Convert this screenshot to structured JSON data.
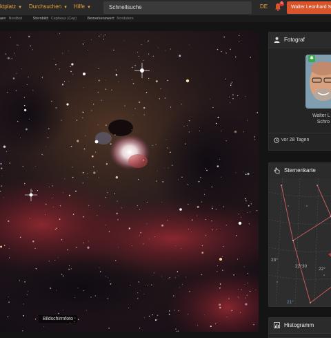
{
  "topbar": {
    "nav": [
      {
        "label": "ktplatz"
      },
      {
        "label": "Durchsuchen"
      },
      {
        "label": "Hilfe"
      }
    ],
    "search_label": "Schnellsuche",
    "lang": "DE",
    "notif_count": "6",
    "user_button": "Walter Leonhard S"
  },
  "infobar": [
    {
      "k": "are:",
      "v": "Nordbot"
    },
    {
      "k": "Sternbild:",
      "v": "Cepheus (Cep)"
    },
    {
      "k": "Bemerkenswert:",
      "v": "Nordstern"
    }
  ],
  "image": {
    "caption": "Bildschirmfoto"
  },
  "photographer": {
    "title": "Fotograf",
    "name_line1": "Walter L",
    "name_line2": "Schro",
    "time": "vor 28 Tagen"
  },
  "starmap": {
    "title": "Sternenkarte",
    "labels": [
      "23°",
      "22°30",
      "22°",
      "21°"
    ]
  },
  "histogram": {
    "title": "Histogramm"
  },
  "colors": {
    "accent": "#e8a23c",
    "user_button": "#d9542b",
    "badge": "#d9342b",
    "online": "#3aa84a"
  }
}
